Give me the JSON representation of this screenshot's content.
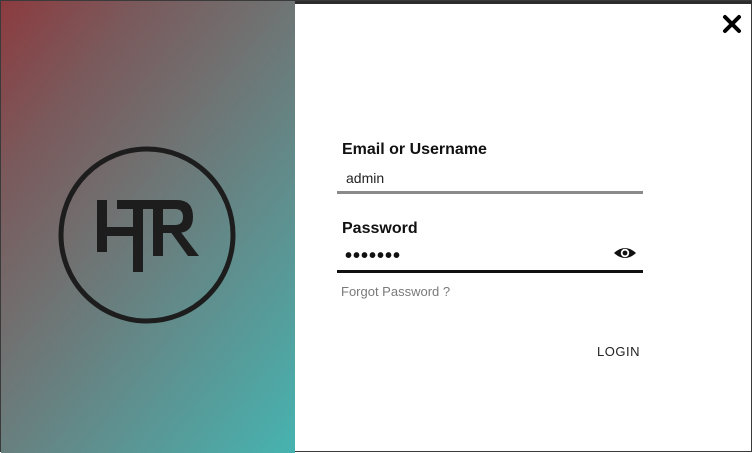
{
  "brand": {
    "logo_icon": "hr-monogram-logo"
  },
  "dialog": {
    "close_icon": "close-icon"
  },
  "login_form": {
    "email_label": "Email or Username",
    "email_value": "admin",
    "password_label": "Password",
    "password_value": "•••••••",
    "show_password_icon": "eye-icon",
    "forgot_password": "Forgot Password ?",
    "login_button": "LOGIN"
  },
  "colors": {
    "panel_gradient_start": "#8c3b3f",
    "panel_gradient_end": "#46b3b0",
    "email_underline": "#8a8a8a",
    "password_underline": "#111111"
  }
}
